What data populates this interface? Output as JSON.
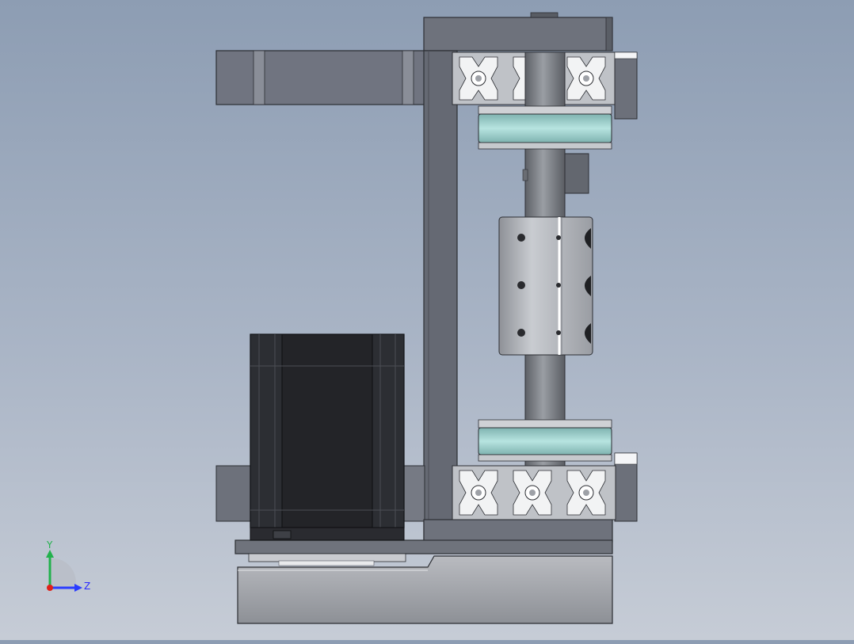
{
  "viewport": {
    "background_top": "#8d9db3",
    "background_bottom": "#c6ccd6",
    "body_color": "#6f737b",
    "motor_color": "#222326",
    "pulley_color": "#9fd3d0",
    "shaft_color": "#7e8186",
    "coupler_color": "#b4b7bd"
  },
  "triad": {
    "y_label": "Y",
    "z_label": "Z",
    "y_color": "#22b14c",
    "z_color": "#2a3cff",
    "x_color": "#e0201a"
  }
}
